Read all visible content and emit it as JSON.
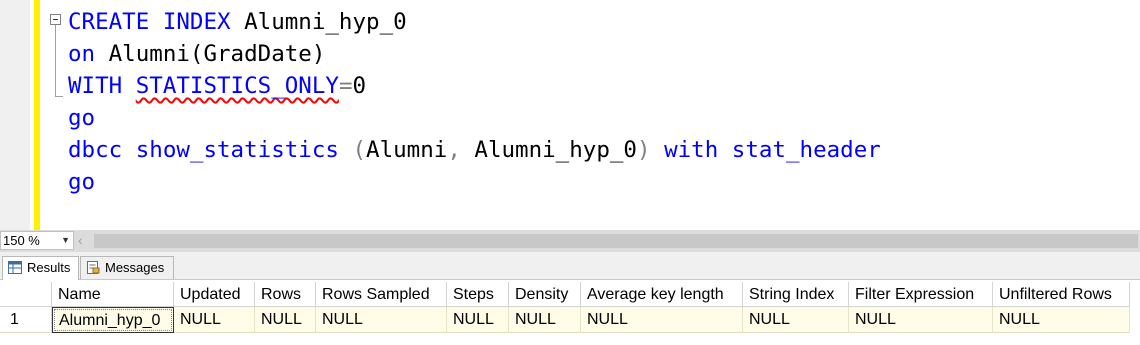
{
  "editor": {
    "lines": [
      [
        {
          "t": "CREATE",
          "c": "kw"
        },
        {
          "t": " "
        },
        {
          "t": "INDEX",
          "c": "kw"
        },
        {
          "t": " Alumni_hyp_0"
        }
      ],
      [
        {
          "t": "on",
          "c": "kw"
        },
        {
          "t": " Alumni(GradDate)"
        }
      ],
      [
        {
          "t": "WITH",
          "c": "kw"
        },
        {
          "t": " "
        },
        {
          "t": "STATISTICS_ONLY",
          "c": "kw squig"
        },
        {
          "t": "=",
          "c": "gr"
        },
        {
          "t": "0"
        }
      ],
      [
        {
          "t": "go",
          "c": "kw"
        }
      ],
      [
        {
          "t": "dbcc",
          "c": "kw"
        },
        {
          "t": " "
        },
        {
          "t": "show_statistics",
          "c": "kw"
        },
        {
          "t": " "
        },
        {
          "t": "(",
          "c": "gr"
        },
        {
          "t": "Alumni"
        },
        {
          "t": ",",
          "c": "gr"
        },
        {
          "t": " Alumni_hyp_0"
        },
        {
          "t": ")",
          "c": "gr"
        },
        {
          "t": " "
        },
        {
          "t": "with",
          "c": "kw"
        },
        {
          "t": " "
        },
        {
          "t": "stat_header",
          "c": "kw"
        }
      ],
      [
        {
          "t": "go",
          "c": "kw"
        }
      ]
    ]
  },
  "status": {
    "zoom": "150 %"
  },
  "tabs": {
    "results": "Results",
    "messages": "Messages"
  },
  "grid": {
    "columns": [
      "Name",
      "Updated",
      "Rows",
      "Rows Sampled",
      "Steps",
      "Density",
      "Average key length",
      "String Index",
      "Filter Expression",
      "Unfiltered Rows"
    ],
    "rows": [
      {
        "num": "1",
        "cells": [
          "Alumni_hyp_0",
          "NULL",
          "NULL",
          "NULL",
          "NULL",
          "NULL",
          "NULL",
          "NULL",
          "NULL",
          "NULL"
        ]
      }
    ]
  }
}
